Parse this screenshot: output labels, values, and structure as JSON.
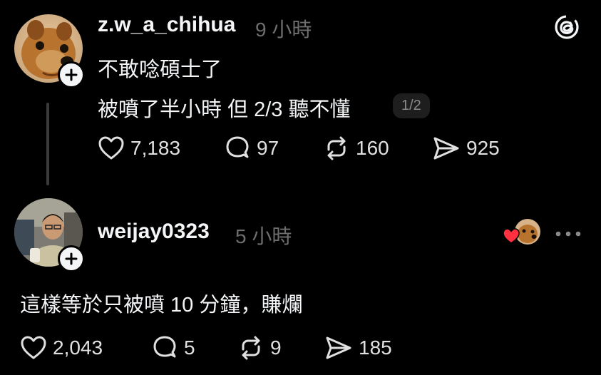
{
  "post1": {
    "username": "z.w_a_chihua",
    "time": "9 小時",
    "line1": "不敢唸碩士了",
    "line2": "被噴了半小時 但 2/3 聽不懂",
    "pager": "1/2",
    "likes": "7,183",
    "comments": "97",
    "reposts": "160",
    "shares": "925"
  },
  "post2": {
    "username": "weijay0323",
    "time": "5 小時",
    "text": "這樣等於只被噴 10 分鐘，賺爛",
    "likes": "2,043",
    "comments": "5",
    "reposts": "9",
    "shares": "185"
  },
  "icons": {
    "threads_logo": "threads-logo-icon",
    "like": "heart-icon",
    "comment": "comment-bubble-icon",
    "repost": "repost-icon",
    "share": "send-icon",
    "more": "more-horizontal-icon",
    "follow": "plus-icon",
    "liked_by_author": "red-heart-icon"
  },
  "colors": {
    "background": "#000000",
    "text": "#f3f5f7",
    "muted": "#6e6e6e",
    "heart_red": "#ff3040"
  }
}
